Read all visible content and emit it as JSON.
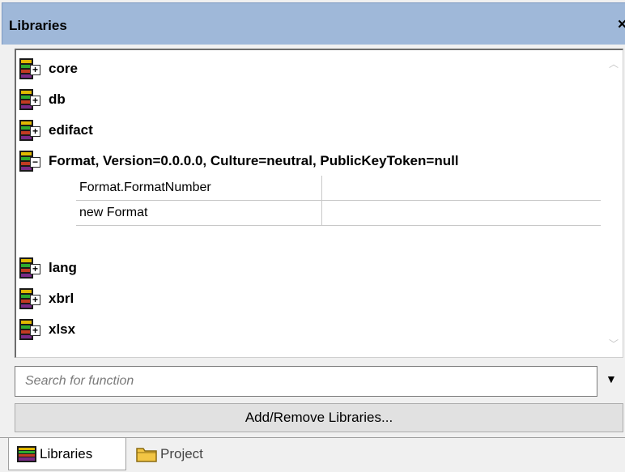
{
  "panel": {
    "title": "Libraries",
    "close_label": "×"
  },
  "libraries": [
    {
      "label": "core",
      "expanded": false
    },
    {
      "label": "db",
      "expanded": false
    },
    {
      "label": "edifact",
      "expanded": false
    },
    {
      "label": "Format, Version=0.0.0.0, Culture=neutral, PublicKeyToken=null",
      "expanded": true
    },
    {
      "label": "lang",
      "expanded": false
    },
    {
      "label": "xbrl",
      "expanded": false
    },
    {
      "label": "xlsx",
      "expanded": false
    }
  ],
  "format_functions": [
    {
      "name": "Format.FormatNumber"
    },
    {
      "name": "new Format"
    }
  ],
  "search": {
    "placeholder": "Search for function"
  },
  "add_remove_button": "Add/Remove Libraries...",
  "tabs": [
    {
      "label": "Libraries",
      "active": true
    },
    {
      "label": "Project",
      "active": false
    }
  ]
}
